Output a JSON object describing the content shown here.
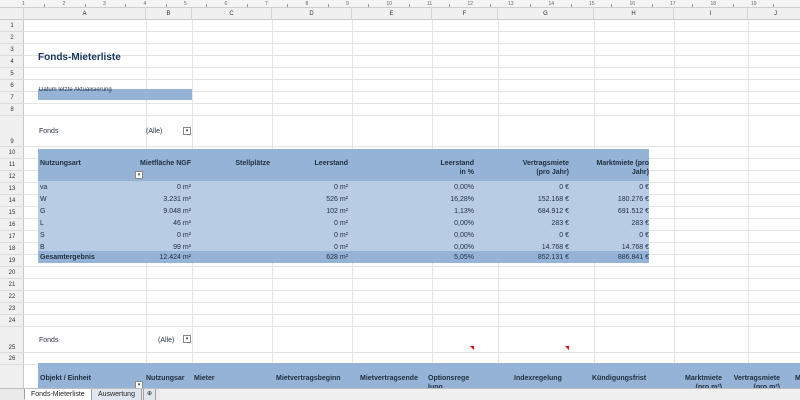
{
  "ruler": {
    "ticks": [
      "1",
      "2",
      "3",
      "4",
      "5",
      "6",
      "7",
      "8",
      "9",
      "10",
      "11",
      "12",
      "13",
      "14",
      "15",
      "16",
      "17",
      "18",
      "19"
    ]
  },
  "columns": [
    "A",
    "B",
    "C",
    "D",
    "E",
    "F",
    "G",
    "H",
    "I",
    "J"
  ],
  "rows": [
    "1",
    "2",
    "3",
    "4",
    "5",
    "6",
    "7",
    "8",
    "9",
    "10",
    "11",
    "12",
    "13",
    "14",
    "15",
    "16",
    "17",
    "18",
    "19",
    "20",
    "21",
    "22",
    "23",
    "24",
    "25",
    "26"
  ],
  "sheet": {
    "title": "Fonds-Mieterliste",
    "datum_label": "Datum letzte Aktualisierung",
    "fonds_label": "Fonds",
    "fonds_value": "(Alle)",
    "pivot1": {
      "headers": {
        "nutzungsart": "Nutzungsart",
        "mietflaeche": "Mietfläche NGF",
        "stellplaetze": "Stellplätze",
        "leerstand": "Leerstand",
        "leerstand_pct": "Leerstand in %",
        "vertragsmiete": "Vertragsmiete (pro Jahr)",
        "marktmiete": "Marktmiete (pro Jahr)"
      },
      "rows": [
        {
          "art": "va",
          "flaeche": "0 m²",
          "leer": "0 m²",
          "pct": "0,00%",
          "vm": "0 €",
          "mm": "0 €"
        },
        {
          "art": "W",
          "flaeche": "3.231 m²",
          "leer": "526 m²",
          "pct": "16,28%",
          "vm": "152.168 €",
          "mm": "180.276 €"
        },
        {
          "art": "G",
          "flaeche": "9.048 m²",
          "leer": "102 m²",
          "pct": "1,13%",
          "vm": "684.912 €",
          "mm": "691.512 €"
        },
        {
          "art": "L",
          "flaeche": "46 m²",
          "leer": "0 m²",
          "pct": "0,00%",
          "vm": "283 €",
          "mm": "283 €"
        },
        {
          "art": "S",
          "flaeche": "0 m²",
          "leer": "0 m²",
          "pct": "0,00%",
          "vm": "0 €",
          "mm": "0 €"
        },
        {
          "art": "B",
          "flaeche": "99 m²",
          "leer": "0 m²",
          "pct": "0,00%",
          "vm": "14.768 €",
          "mm": "14.768 €"
        }
      ],
      "total": {
        "label": "Gesamtergebnis",
        "flaeche": "12.424 m²",
        "leer": "628 m²",
        "pct": "5,05%",
        "vm": "852.131 €",
        "mm": "886.841 €"
      }
    },
    "fonds2_label": "Fonds",
    "fonds2_value": "(Alle)",
    "pivot2_headers": {
      "objekt": "Objekt / Einheit",
      "nutzungsart": "Nutzungsar",
      "mieter": "Mieter",
      "beginn": "Mietvertragsbeginn",
      "ende": "Mietvertragsende",
      "option": "Optionsrege lung",
      "index": "Indexregelung",
      "kuendigung": "Kündigungsfrist",
      "marktmiete": "Marktmiete (pro m²)",
      "vertragsmiete": "Vertragsmiete (pro m²)",
      "m": "M"
    }
  },
  "tabs": [
    "Fonds-Mieterliste",
    "Auswertung"
  ],
  "colors": {
    "band": "#b8cce4",
    "header": "#95b3d7",
    "title": "#17365d"
  }
}
